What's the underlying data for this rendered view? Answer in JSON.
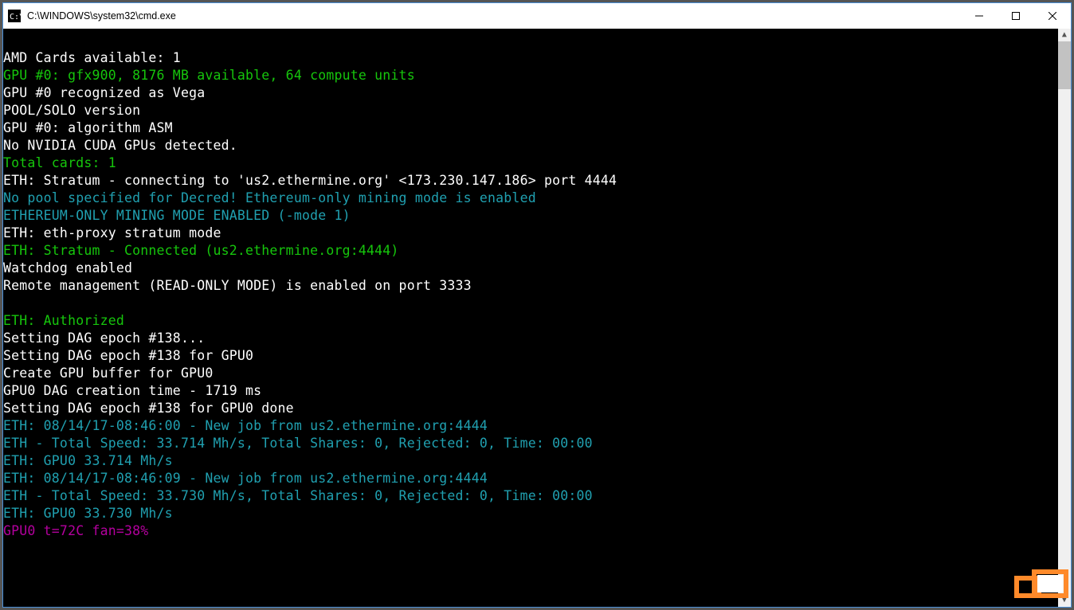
{
  "window": {
    "title": "C:\\WINDOWS\\system32\\cmd.exe"
  },
  "lines": [
    {
      "cls": "white",
      "text": ""
    },
    {
      "cls": "white",
      "text": "AMD Cards available: 1"
    },
    {
      "cls": "green",
      "text": "GPU #0: gfx900, 8176 MB available, 64 compute units"
    },
    {
      "cls": "white",
      "text": "GPU #0 recognized as Vega"
    },
    {
      "cls": "white",
      "text": "POOL/SOLO version"
    },
    {
      "cls": "white",
      "text": "GPU #0: algorithm ASM"
    },
    {
      "cls": "white",
      "text": "No NVIDIA CUDA GPUs detected."
    },
    {
      "cls": "green",
      "text": "Total cards: 1"
    },
    {
      "cls": "white",
      "text": "ETH: Stratum - connecting to 'us2.ethermine.org' <173.230.147.186> port 4444"
    },
    {
      "cls": "cyan",
      "text": "No pool specified for Decred! Ethereum-only mining mode is enabled"
    },
    {
      "cls": "cyan",
      "text": "ETHEREUM-ONLY MINING MODE ENABLED (-mode 1)"
    },
    {
      "cls": "white",
      "text": "ETH: eth-proxy stratum mode"
    },
    {
      "cls": "green",
      "text": "ETH: Stratum - Connected (us2.ethermine.org:4444)"
    },
    {
      "cls": "white",
      "text": "Watchdog enabled"
    },
    {
      "cls": "white",
      "text": "Remote management (READ-ONLY MODE) is enabled on port 3333"
    },
    {
      "cls": "white",
      "text": ""
    },
    {
      "cls": "green",
      "text": "ETH: Authorized"
    },
    {
      "cls": "white",
      "text": "Setting DAG epoch #138..."
    },
    {
      "cls": "white",
      "text": "Setting DAG epoch #138 for GPU0"
    },
    {
      "cls": "white",
      "text": "Create GPU buffer for GPU0"
    },
    {
      "cls": "white",
      "text": "GPU0 DAG creation time - 1719 ms"
    },
    {
      "cls": "white",
      "text": "Setting DAG epoch #138 for GPU0 done"
    },
    {
      "cls": "cyan",
      "text": "ETH: 08/14/17-08:46:00 - New job from us2.ethermine.org:4444"
    },
    {
      "cls": "cyan",
      "text": "ETH - Total Speed: 33.714 Mh/s, Total Shares: 0, Rejected: 0, Time: 00:00"
    },
    {
      "cls": "cyan",
      "text": "ETH: GPU0 33.714 Mh/s"
    },
    {
      "cls": "cyan",
      "text": "ETH: 08/14/17-08:46:09 - New job from us2.ethermine.org:4444"
    },
    {
      "cls": "cyan",
      "text": "ETH - Total Speed: 33.730 Mh/s, Total Shares: 0, Rejected: 0, Time: 00:00"
    },
    {
      "cls": "cyan",
      "text": "ETH: GPU0 33.730 Mh/s"
    },
    {
      "cls": "magenta",
      "text": "GPU0 t=72C fan=38%"
    }
  ]
}
